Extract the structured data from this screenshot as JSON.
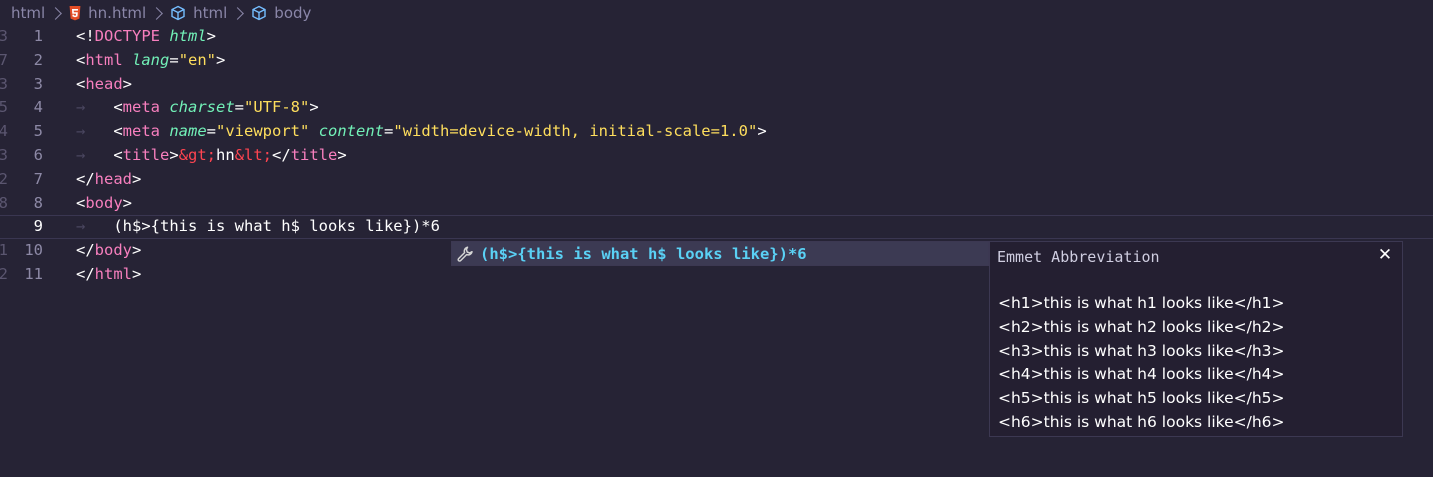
{
  "breadcrumb": {
    "items": [
      {
        "label": "html",
        "icon": null
      },
      {
        "label": "hn.html",
        "icon": "html5-file-icon"
      },
      {
        "label": "html",
        "icon": "cube-icon"
      },
      {
        "label": "body",
        "icon": "cube-icon"
      }
    ]
  },
  "gutter": {
    "fold_numbers": [
      "3",
      "7",
      "3",
      "5",
      "4",
      "3",
      "2",
      "8",
      "",
      "1",
      "2"
    ],
    "line_numbers": [
      "1",
      "2",
      "3",
      "4",
      "5",
      "6",
      "7",
      "8",
      "9",
      "10",
      "11"
    ],
    "current_line": "9"
  },
  "code": {
    "lines": [
      [
        {
          "t": "<!",
          "c": "punc"
        },
        {
          "t": "DOCTYPE",
          "c": "doctype"
        },
        {
          "t": " ",
          "c": "text"
        },
        {
          "t": "html",
          "c": "html-kw"
        },
        {
          "t": ">",
          "c": "punc"
        }
      ],
      [
        {
          "t": "<",
          "c": "punc"
        },
        {
          "t": "html",
          "c": "tag"
        },
        {
          "t": " ",
          "c": "text"
        },
        {
          "t": "lang",
          "c": "attr"
        },
        {
          "t": "=",
          "c": "punc"
        },
        {
          "t": "\"en\"",
          "c": "str2"
        },
        {
          "t": ">",
          "c": "punc"
        }
      ],
      [
        {
          "t": "<",
          "c": "punc"
        },
        {
          "t": "head",
          "c": "tag"
        },
        {
          "t": ">",
          "c": "punc"
        }
      ],
      [
        {
          "t": "    ",
          "c": "ws"
        },
        {
          "t": "<",
          "c": "punc"
        },
        {
          "t": "meta",
          "c": "tag"
        },
        {
          "t": " ",
          "c": "text"
        },
        {
          "t": "charset",
          "c": "attr"
        },
        {
          "t": "=",
          "c": "punc"
        },
        {
          "t": "\"UTF-8\"",
          "c": "str2"
        },
        {
          "t": ">",
          "c": "punc"
        }
      ],
      [
        {
          "t": "    ",
          "c": "ws"
        },
        {
          "t": "<",
          "c": "punc"
        },
        {
          "t": "meta",
          "c": "tag"
        },
        {
          "t": " ",
          "c": "text"
        },
        {
          "t": "name",
          "c": "attr"
        },
        {
          "t": "=",
          "c": "punc"
        },
        {
          "t": "\"viewport\"",
          "c": "str2"
        },
        {
          "t": " ",
          "c": "text"
        },
        {
          "t": "content",
          "c": "attr"
        },
        {
          "t": "=",
          "c": "punc"
        },
        {
          "t": "\"width=device-width, initial-scale=1.0\"",
          "c": "str2"
        },
        {
          "t": ">",
          "c": "punc"
        }
      ],
      [
        {
          "t": "    ",
          "c": "ws"
        },
        {
          "t": "<",
          "c": "punc"
        },
        {
          "t": "title",
          "c": "tag"
        },
        {
          "t": ">",
          "c": "punc"
        },
        {
          "t": "&gt;",
          "c": "ent"
        },
        {
          "t": "hn",
          "c": "text"
        },
        {
          "t": "&lt;",
          "c": "ent"
        },
        {
          "t": "</",
          "c": "punc"
        },
        {
          "t": "title",
          "c": "tag"
        },
        {
          "t": ">",
          "c": "punc"
        }
      ],
      [
        {
          "t": "</",
          "c": "punc"
        },
        {
          "t": "head",
          "c": "tag"
        },
        {
          "t": ">",
          "c": "punc"
        }
      ],
      [
        {
          "t": "<",
          "c": "punc"
        },
        {
          "t": "body",
          "c": "tag"
        },
        {
          "t": ">",
          "c": "punc"
        }
      ],
      [
        {
          "t": "    ",
          "c": "ws"
        },
        {
          "t": "(h$>{this is what h$ looks like})*6",
          "c": "text"
        }
      ],
      [
        {
          "t": "</",
          "c": "punc"
        },
        {
          "t": "body",
          "c": "tag"
        },
        {
          "t": ">",
          "c": "punc"
        }
      ],
      [
        {
          "t": "</",
          "c": "punc"
        },
        {
          "t": "html",
          "c": "tag"
        },
        {
          "t": ">",
          "c": "punc"
        }
      ]
    ]
  },
  "suggestion": {
    "icon": "wrench-icon",
    "label": "(h$>{this is what h$ looks like})*6"
  },
  "details": {
    "title": "Emmet Abbreviation",
    "close_icon": "close-icon",
    "lines": [
      "<h1>this is what h1 looks like</h1>",
      "<h2>this is what h2 looks like</h2>",
      "<h3>this is what h3 looks like</h3>",
      "<h4>this is what h4 looks like</h4>",
      "<h5>this is what h5 looks like</h5>",
      "<h6>this is what h6 looks like</h6>"
    ]
  },
  "colors": {
    "background": "#262335",
    "tag": "#f77fbe",
    "attribute": "#72f1b8",
    "string": "#fede5d",
    "entity": "#fe4450",
    "suggestion_label": "#5ad1f5"
  }
}
